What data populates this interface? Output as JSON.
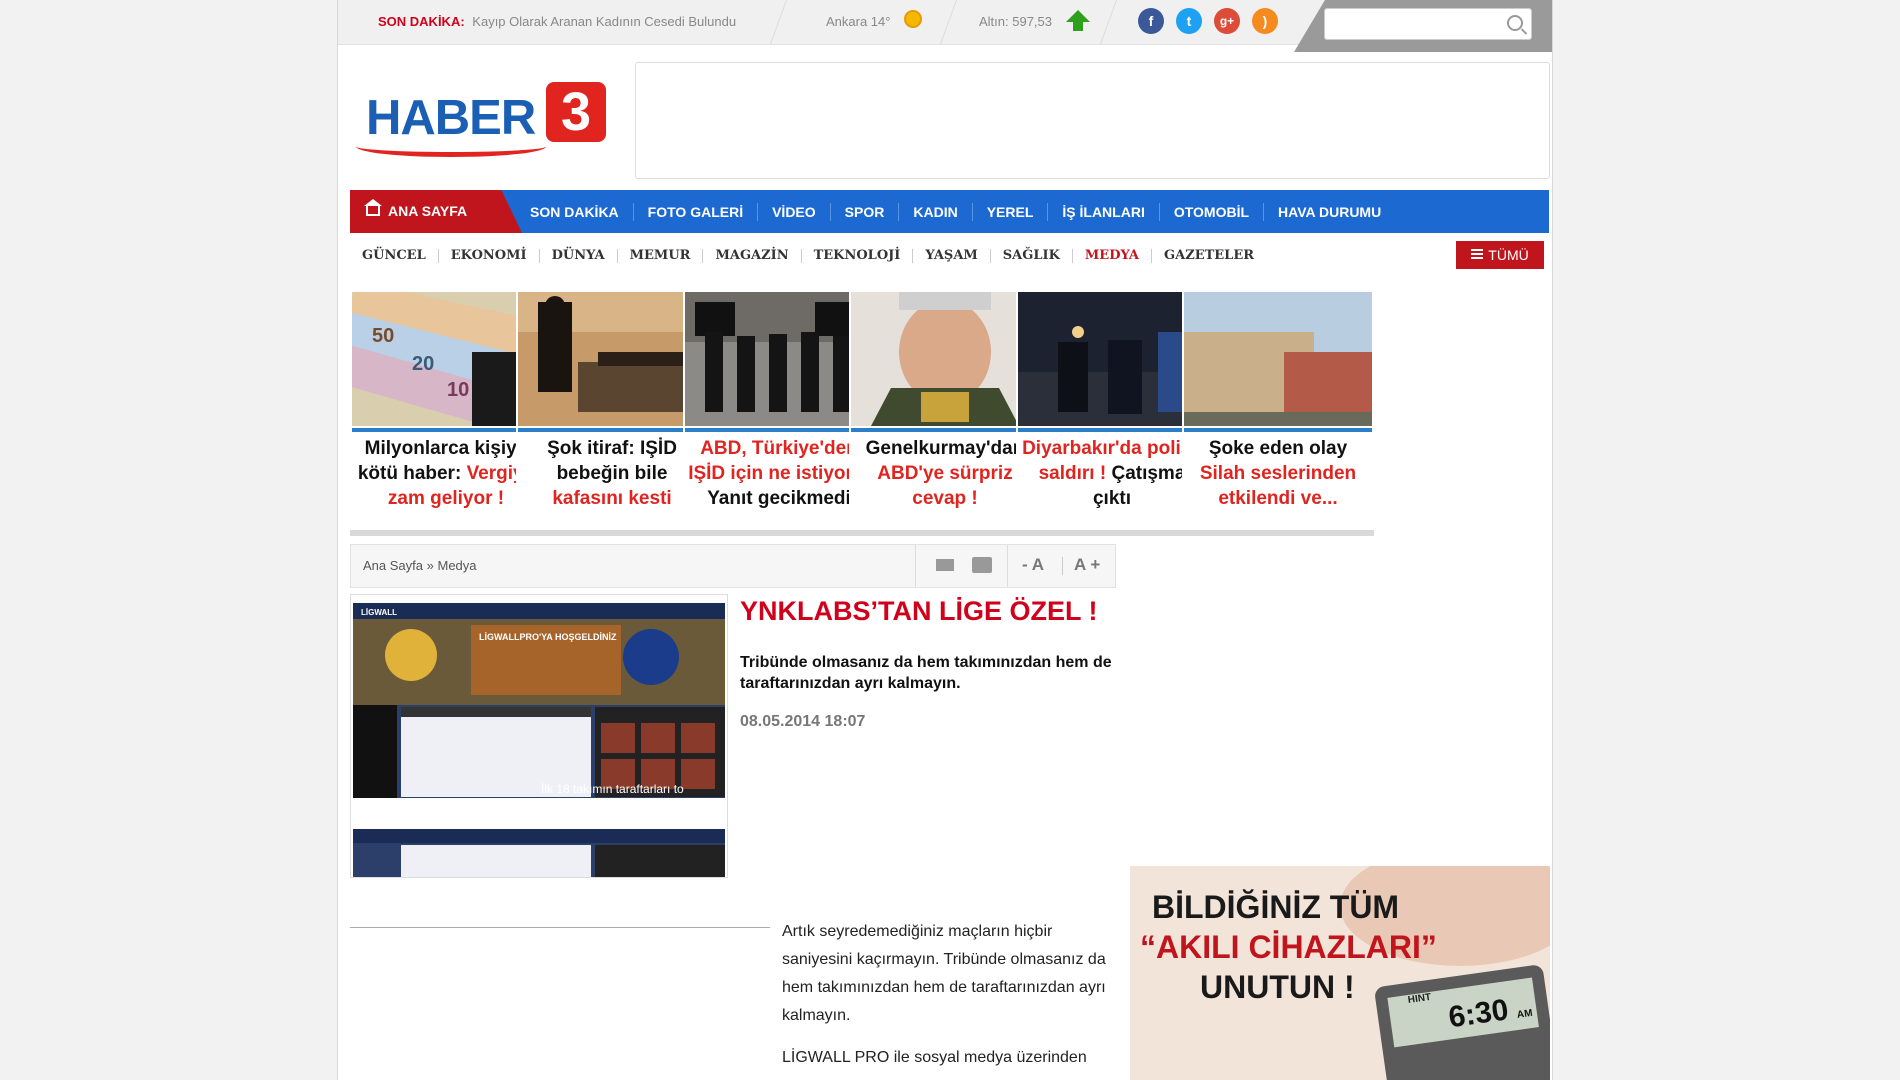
{
  "topbar": {
    "ticker_label": "SON DAKİKA:",
    "ticker_text": "Kayıp Olarak Aranan Kadının Cesedi Bulundu",
    "weather": "Ankara 14°",
    "gold": "Altın: 597,53",
    "social": [
      "facebook-icon",
      "twitter-icon",
      "google-plus-icon",
      "rss-icon"
    ],
    "search_placeholder": ""
  },
  "header": {
    "logo_word": "HABER",
    "logo_number": "3"
  },
  "mainnav": {
    "home": "ANA SAYFA",
    "items": [
      "SON DAKİKA",
      "FOTO GALERİ",
      "VİDEO",
      "SPOR",
      "KADIN",
      "YEREL",
      "İŞ İLANLARI",
      "OTOMOBİL",
      "HAVA DURUMU"
    ]
  },
  "subnav": {
    "items": [
      "GÜNCEL",
      "EKONOMİ",
      "DÜNYA",
      "MEMUR",
      "MAGAZİN",
      "TEKNOLOJİ",
      "YAŞAM",
      "SAĞLIK",
      "MEDYA",
      "GAZETELER"
    ],
    "all_label": "TÜMÜ"
  },
  "cards": [
    {
      "l1": "Milyonlarca kişiye",
      "l2a": "kötü haber: ",
      "l2b": "Vergiye",
      "l3": "zam geliyor !"
    },
    {
      "l1": "Şok itiraf: IŞİD",
      "l2": "bebeğin bile",
      "l3": "kafasını kesti"
    },
    {
      "l1": "ABD, Türkiye'den",
      "l2": "IŞİD için ne istiyor ?",
      "l3": "Yanıt gecikmedi"
    },
    {
      "l1": "Genelkurmay'dan",
      "l2": "ABD'ye sürpriz",
      "l3": "cevap !"
    },
    {
      "l1": "Diyarbakır'da polise",
      "l2a": "saldırı ! ",
      "l2b": "Çatışma",
      "l3": "çıktı"
    },
    {
      "l1": "Şoke eden olay",
      "l2": "Silah seslerinden",
      "l3": "etkilendi ve..."
    }
  ],
  "breadcrumb": {
    "home": "Ana Sayfa",
    "sep": "»",
    "section": "Medya"
  },
  "fontsize": {
    "smaller": "- A",
    "larger": "A +"
  },
  "article": {
    "headline": "YNKLABS’TAN LİGE ÖZEL !",
    "summary": "Tribünde olmasanız da hem takımınızdan hem de taraftarınızdan ayrı kalmayın.",
    "date": "08.05.2014 18:07",
    "image_caption": "İlk 18 takımın taraftarları to",
    "image_banner": "LİGWALLPRO'YA HOŞGELDİNİZ",
    "image_brand": "LİGWALL",
    "p1": "Artık seyredemediğiniz maçların hiçbir saniyesini kaçırmayın. Tribünde olmasanız da hem takımınızdan hem de taraftarınızdan ayrı kalmayın.",
    "p2": "LİGWALL PRO ile sosyal medya üzerinden"
  },
  "sidead": {
    "line1": "BİLDİĞİNİZ TÜM",
    "line2": "“AKILI CİHAZLARI”",
    "line3": "UNUTUN !",
    "display": "6:30",
    "unit": "AM",
    "hint": "HINT"
  },
  "colors": {
    "brand_red": "#d0021b",
    "nav_blue": "#1c6ad1",
    "accent_blue": "#2b7fc8"
  }
}
